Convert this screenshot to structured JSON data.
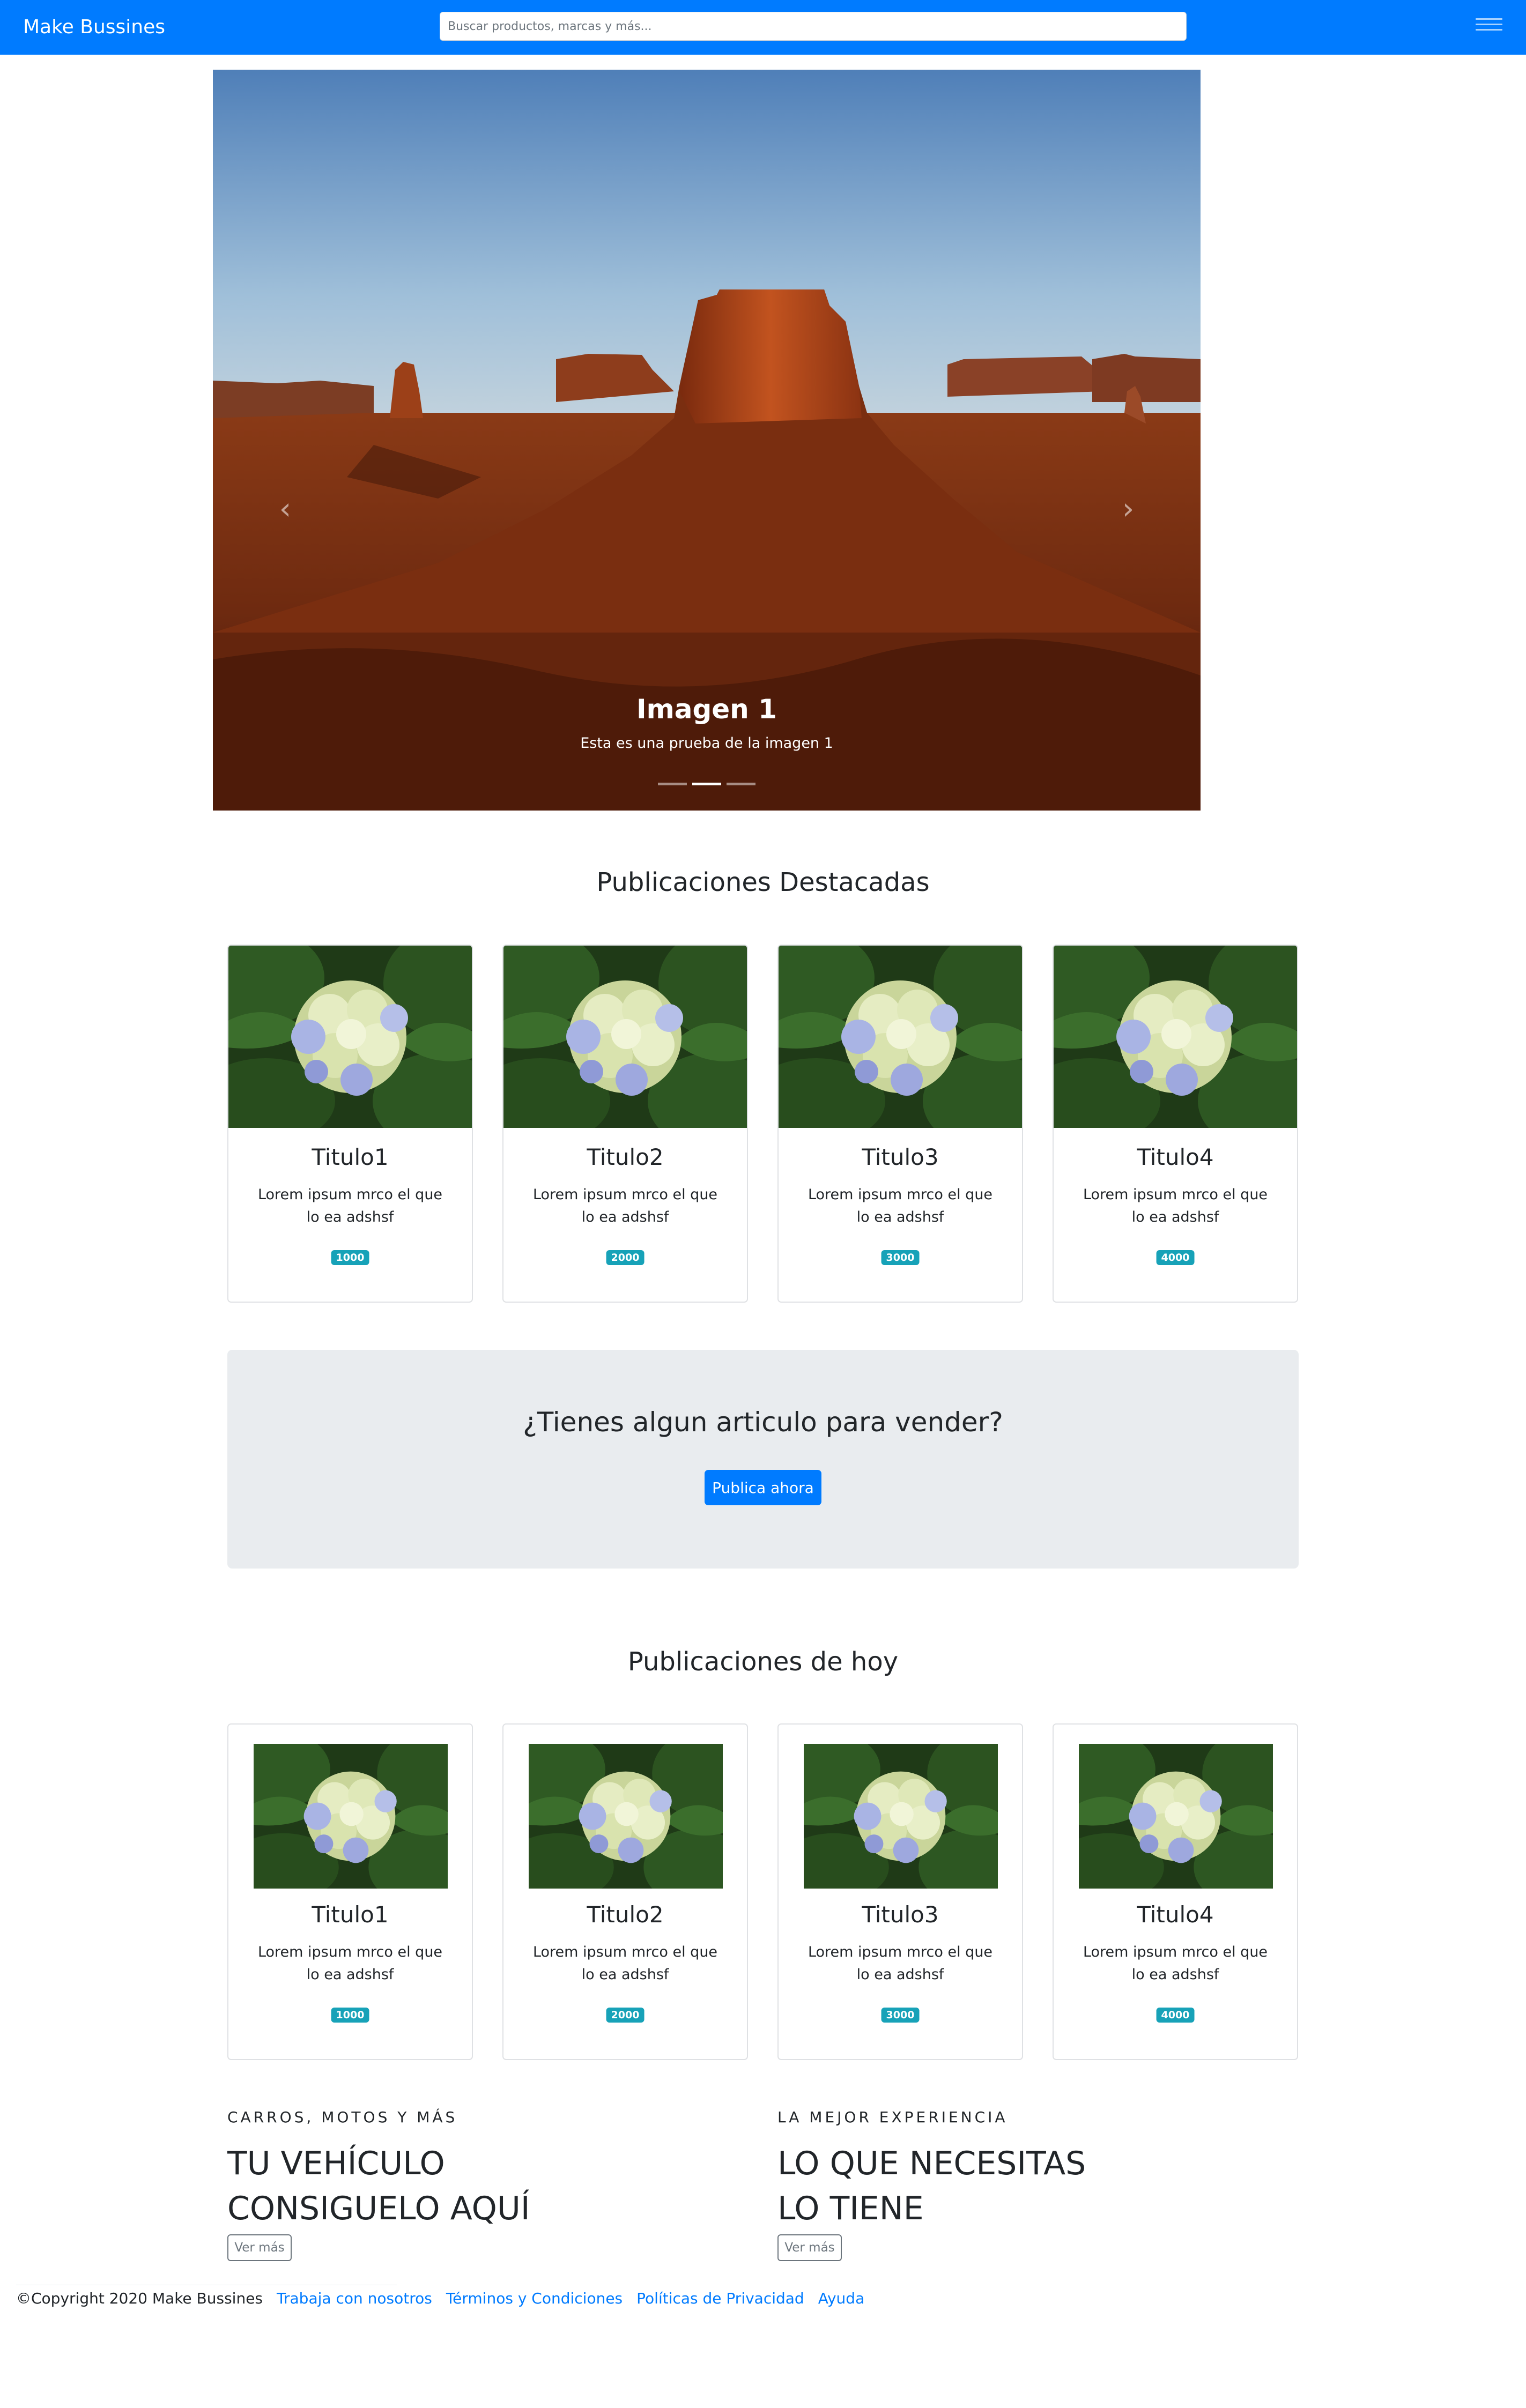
{
  "navbar": {
    "brand": "Make Bussines",
    "search_placeholder": "Buscar productos, marcas y más...",
    "menu_icon": "hamburger-icon",
    "color": "#007bff"
  },
  "carousel": {
    "caption_title": "Imagen 1",
    "caption_text": "Esta es una prueba de la imagen 1",
    "prev_icon": "chevron-left-icon",
    "next_icon": "chevron-right-icon",
    "slides": 3,
    "active_slide": 2
  },
  "featured": {
    "title": "Publicaciones Destacadas",
    "cards": [
      {
        "title": "Titulo1",
        "text": "Lorem ipsum mrco el que lo ea adshsf",
        "badge": "1000"
      },
      {
        "title": "Titulo2",
        "text": "Lorem ipsum mrco el que lo ea adshsf",
        "badge": "2000"
      },
      {
        "title": "Titulo3",
        "text": "Lorem ipsum mrco el que lo ea adshsf",
        "badge": "3000"
      },
      {
        "title": "Titulo4",
        "text": "Lorem ipsum mrco el que lo ea adshsf",
        "badge": "4000"
      }
    ]
  },
  "cta": {
    "title": "¿Tienes algun articulo para vender?",
    "button": "Publica ahora"
  },
  "today": {
    "title": "Publicaciones de hoy",
    "cards": [
      {
        "title": "Titulo1",
        "text": "Lorem ipsum mrco el que lo ea adshsf",
        "badge": "1000"
      },
      {
        "title": "Titulo2",
        "text": "Lorem ipsum mrco el que lo ea adshsf",
        "badge": "2000"
      },
      {
        "title": "Titulo3",
        "text": "Lorem ipsum mrco el que lo ea adshsf",
        "badge": "3000"
      },
      {
        "title": "Titulo4",
        "text": "Lorem ipsum mrco el que lo ea adshsf",
        "badge": "4000"
      }
    ]
  },
  "promos": [
    {
      "eyebrow": "CARROS, MOTOS Y MÁS",
      "line1": "TU VEHÍCULO",
      "line2": "CONSIGUELO AQUÍ",
      "button": "Ver más"
    },
    {
      "eyebrow": "LA MEJOR EXPERIENCIA",
      "line1": "LO QUE NECESITAS",
      "line2": "LO TIENE",
      "button": "Ver más"
    }
  ],
  "footer": {
    "copyright": "©Copyright 2020 Make Bussines",
    "links": [
      "Trabaja con nosotros",
      "Términos y Condiciones",
      "Políticas de Privacidad",
      "Ayuda"
    ]
  }
}
